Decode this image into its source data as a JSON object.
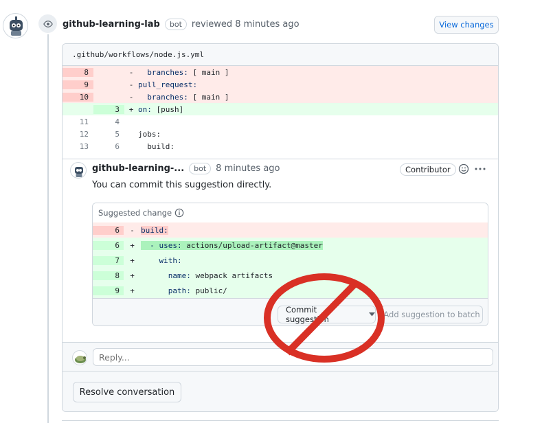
{
  "review": {
    "author": "github-learning-lab",
    "badge": "bot",
    "action_text": "reviewed 8 minutes ago",
    "view_changes_label": "View changes"
  },
  "file": {
    "path": ".github/workflows/node.js.yml",
    "rows": [
      {
        "type": "del",
        "old": "8",
        "new": "",
        "sign": "-",
        "key": "  branches:",
        "val": " [ main ]"
      },
      {
        "type": "del",
        "old": "9",
        "new": "",
        "sign": "-",
        "key": "pull_request:",
        "val": ""
      },
      {
        "type": "del",
        "old": "10",
        "new": "",
        "sign": "-",
        "key": "  branches:",
        "val": " [ main ]"
      },
      {
        "type": "add",
        "old": "",
        "new": "3",
        "sign": "+",
        "key": "on:",
        "val": " [push]"
      },
      {
        "type": "ctx",
        "old": "11",
        "new": "4",
        "sign": "",
        "key": "",
        "val": ""
      },
      {
        "type": "ctx",
        "old": "12",
        "new": "5",
        "sign": "",
        "key": "jobs:",
        "val": ""
      },
      {
        "type": "ctx",
        "old": "13",
        "new": "6",
        "sign": "",
        "key": "  build:",
        "val": ""
      }
    ]
  },
  "comment": {
    "author": "github-learning-...",
    "badge": "bot",
    "time": "8 minutes ago",
    "role": "Contributor",
    "body": "You can commit this suggestion directly."
  },
  "suggestion": {
    "header": "Suggested change",
    "rows": [
      {
        "type": "del",
        "ln": "6",
        "sign": "-",
        "indent": "",
        "key": "build:",
        "val": "",
        "highlight": true
      },
      {
        "type": "add",
        "ln": "6",
        "sign": "+",
        "indent": "",
        "key": "  - uses:",
        "val": " actions/upload-artifact@master",
        "highlight": true
      },
      {
        "type": "add",
        "ln": "7",
        "sign": "+",
        "indent": "    ",
        "key": "with:",
        "val": "",
        "highlight": false
      },
      {
        "type": "add",
        "ln": "8",
        "sign": "+",
        "indent": "      ",
        "key": "name:",
        "val": " webpack artifacts",
        "highlight": false
      },
      {
        "type": "add",
        "ln": "9",
        "sign": "+",
        "indent": "      ",
        "key": "path:",
        "val": " public/",
        "highlight": false
      }
    ],
    "commit_label": "Commit suggestion",
    "batch_label": "Add suggestion to batch"
  },
  "reply": {
    "placeholder": "Reply..."
  },
  "resolve_label": "Resolve conversation",
  "colors": {
    "overlay_red": "#d93025",
    "link_blue": "#0969da",
    "del_bg": "#ffebe9",
    "add_bg": "#e6ffec"
  }
}
